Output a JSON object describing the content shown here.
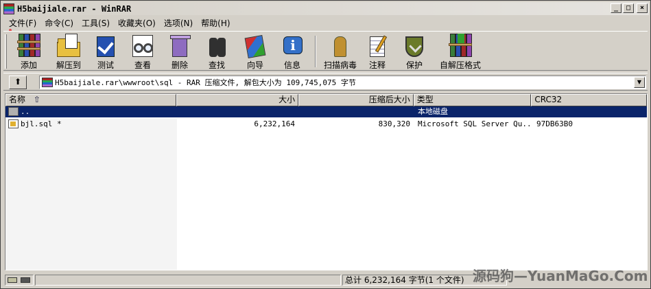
{
  "window": {
    "title": "H5baijiale.rar - WinRAR",
    "controls": [
      "0",
      "1",
      "r"
    ]
  },
  "menu": [
    {
      "label": "文件(F)"
    },
    {
      "label": "命令(C)"
    },
    {
      "label": "工具(S)"
    },
    {
      "label": "收藏夹(O)"
    },
    {
      "label": "选项(N)"
    },
    {
      "label": "帮助(H)"
    }
  ],
  "toolbar": [
    {
      "label": "添加",
      "icon": "add-books-icon"
    },
    {
      "label": "解压到",
      "icon": "extract-folder-icon"
    },
    {
      "label": "测试",
      "icon": "test-check-icon"
    },
    {
      "label": "查看",
      "icon": "view-glasses-icon"
    },
    {
      "label": "删除",
      "icon": "delete-trash-icon"
    },
    {
      "label": "查找",
      "icon": "find-binoculars-icon"
    },
    {
      "label": "向导",
      "icon": "wizard-wand-icon"
    },
    {
      "label": "信息",
      "icon": "info-icon"
    },
    {
      "label": "扫描病毒",
      "icon": "scan-virus-icon"
    },
    {
      "label": "注释",
      "icon": "comment-pen-icon"
    },
    {
      "label": "保护",
      "icon": "protect-shield-icon"
    },
    {
      "label": "自解压格式",
      "icon": "sfx-books-icon"
    }
  ],
  "address": {
    "up_label": "⬆",
    "path": "H5baijiale.rar\\wwwroot\\sql - RAR 压缩文件, 解包大小为 109,745,075 字节",
    "dropdown": "▼"
  },
  "columns": {
    "name": "名称",
    "sort_arrow": "⇧",
    "size": "大小",
    "packed": "压缩后大小",
    "type": "类型",
    "crc": "CRC32"
  },
  "rows": [
    {
      "name": "..",
      "size": "",
      "packed": "",
      "type": "本地磁盘",
      "crc": "",
      "selected": true,
      "icon": "folder-up-icon"
    },
    {
      "name": "bjl.sql *",
      "size": "6,232,164",
      "packed": "830,320",
      "type": "Microsoft SQL Server Qu...",
      "crc": "97DB63B0",
      "selected": false,
      "icon": "sql-file-icon"
    }
  ],
  "status": {
    "summary": "总计 6,232,164 字节(1 个文件)"
  },
  "watermark": "源码狗—YuanMaGo.Com"
}
